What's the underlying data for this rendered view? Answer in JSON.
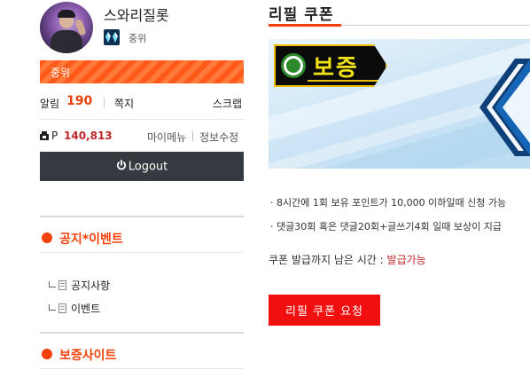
{
  "profile": {
    "nickname": "스와리질롯",
    "rank": "중위",
    "rank_icon": "rank-diamond-icon",
    "level_label": "중위",
    "level_progress": 1.0,
    "alarm_label": "알림",
    "alarm_count": "190",
    "message_label": "쪽지",
    "scrap_label": "스크랩",
    "points_prefix": "P",
    "points": "140,813",
    "mymenu_label": "마이메뉴",
    "edit_label": "정보수정",
    "logout_label": "Logout"
  },
  "sections": [
    {
      "title": "공지*이벤트",
      "items": [
        "공지사항",
        "이벤트"
      ]
    },
    {
      "title": "보증사이트",
      "items": []
    }
  ],
  "main": {
    "title": "리필 쿠폰",
    "banner_text": "보증",
    "notes": [
      "· 8시간에 1회 보유 포인트가 10,000 이하일때 신청 가능",
      "· 댓글30회 혹은 댓글20회+글쓰기4회 일때 보상이 지급"
    ],
    "status_label": "쿠폰 발급까지 남은 시간 : ",
    "status_value": "발급가능",
    "request_button": "리필 쿠폰 요청"
  },
  "colors": {
    "accent": "#f2410b",
    "logout_bg": "#343a40",
    "request_bg": "#f20f0f",
    "point_value": "#c0262a"
  }
}
